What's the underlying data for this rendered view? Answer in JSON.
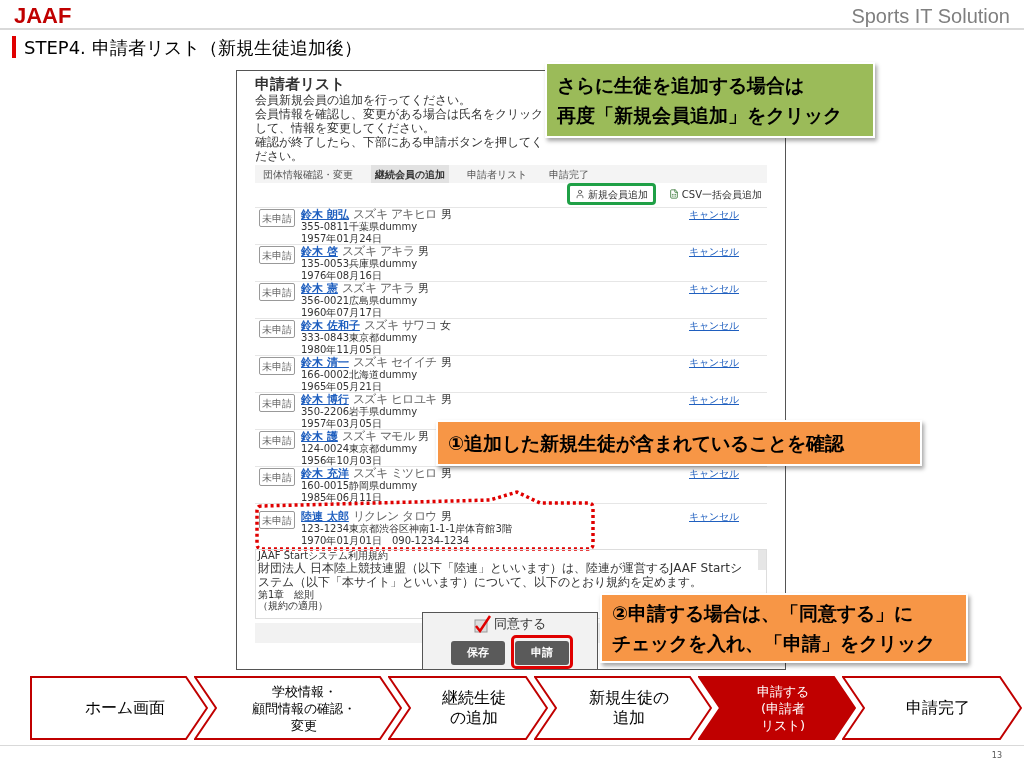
{
  "header": {
    "logo": "JAAF",
    "brand": "Sports IT Solution"
  },
  "slide_title": "STEP4. 申請者リスト（新規生徒追加後）",
  "screen": {
    "title": "申請者リスト",
    "intro": [
      "会員新規会員の追加を行ってください。",
      "会員情報を確認し、変更がある場合は氏名をクリックして、情報を変更してください。",
      "確認が終了したら、下部にある申請ボタンを押してください。"
    ],
    "steps": [
      {
        "label": "団体情報確認・変更",
        "selected": false
      },
      {
        "label": "継続会員の追加",
        "selected": true
      },
      {
        "label": "申請者リスト",
        "selected": false
      },
      {
        "label": "申請完了",
        "selected": false
      }
    ],
    "actions": [
      {
        "kind": "person",
        "label": "新規会員追加",
        "highlighted": true
      },
      {
        "kind": "csv",
        "label": "CSV一括会員追加",
        "highlighted": false
      }
    ],
    "members": [
      {
        "status": "未申請",
        "name": "鈴木 朗弘",
        "kana": "スズキ アキヒロ",
        "sex": "男",
        "address": "355-0811千葉県dummy",
        "birth": "1957年01月24日",
        "cancel": "キャンセル"
      },
      {
        "status": "未申請",
        "name": "鈴木 啓",
        "kana": "スズキ アキラ",
        "sex": "男",
        "address": "135-0053兵庫県dummy",
        "birth": "1976年08月16日",
        "cancel": "キャンセル"
      },
      {
        "status": "未申請",
        "name": "鈴木 憲",
        "kana": "スズキ アキラ",
        "sex": "男",
        "address": "356-0021広島県dummy",
        "birth": "1960年07月17日",
        "cancel": "キャンセル"
      },
      {
        "status": "未申請",
        "name": "鈴木 佐和子",
        "kana": "スズキ サワコ",
        "sex": "女",
        "address": "333-0843東京都dummy",
        "birth": "1980年11月05日",
        "cancel": "キャンセル"
      },
      {
        "status": "未申請",
        "name": "鈴木 清一",
        "kana": "スズキ セイイチ",
        "sex": "男",
        "address": "166-0002北海道dummy",
        "birth": "1965年05月21日",
        "cancel": "キャンセル"
      },
      {
        "status": "未申請",
        "name": "鈴木 博行",
        "kana": "スズキ ヒロユキ",
        "sex": "男",
        "address": "350-2206岩手県dummy",
        "birth": "1957年03月05日",
        "cancel": "キャンセル"
      },
      {
        "status": "未申請",
        "name": "鈴木 護",
        "kana": "スズキ マモル",
        "sex": "男",
        "address": "124-0024東京都dummy",
        "birth": "1956年10月03日"
      },
      {
        "status": "未申請",
        "name": "鈴木 充洋",
        "kana": "スズキ ミツヒロ",
        "sex": "男",
        "address": "160-0015静岡県dummy",
        "birth": "1985年06月11日",
        "cancel": "キャンセル"
      },
      {
        "status": "未申請",
        "name": "陸連 太郎",
        "kana": "リクレン タロウ",
        "sex": "男",
        "address": "123-1234東京都渋谷区神南1-1-1岸体育館3階",
        "birth": "1970年01月01日",
        "phone": "090-1234-1234",
        "cancel": "キャンセル",
        "highlighted": true
      }
    ],
    "terms": {
      "title": "JAAF Startシステム利用規約",
      "body": "財団法人 日本陸上競技連盟（以下「陸連」といいます）は、陸連が運営するJAAF Startシステム（以下「本サイト」といいます）について、以下のとおり規約を定めます。",
      "chapter": "第1章　総則",
      "article": "（規約の適用）"
    }
  },
  "consent": {
    "label": "同意する",
    "checked": true
  },
  "buttons": [
    {
      "label": "保存",
      "highlighted": false
    },
    {
      "label": "申請",
      "highlighted": true
    }
  ],
  "callouts": [
    {
      "kind": "green",
      "lines": [
        "さらに生徒を追加する場合は",
        "再度「新規会員追加」をクリック"
      ]
    },
    {
      "kind": "orange",
      "lines": [
        "①追加した新規生徒が含まれていることを確認"
      ]
    },
    {
      "kind": "orange",
      "lines": [
        "②申請する場合は、「同意する」に",
        "チェックを入れ、「申請」をクリック"
      ]
    }
  ],
  "flow": [
    {
      "lines": [
        "ホーム画面"
      ],
      "selected": false
    },
    {
      "lines": [
        "学校情報・",
        "顧問情報の確認・",
        "変更"
      ],
      "selected": false
    },
    {
      "lines": [
        "継続生徒",
        "の追加"
      ],
      "selected": false
    },
    {
      "lines": [
        "新規生徒の",
        "追加"
      ],
      "selected": false
    },
    {
      "lines": [
        "申請する",
        "(申請者",
        "リスト)"
      ],
      "selected": true
    },
    {
      "lines": [
        "申請完了"
      ],
      "selected": false
    }
  ],
  "page_number": "13"
}
